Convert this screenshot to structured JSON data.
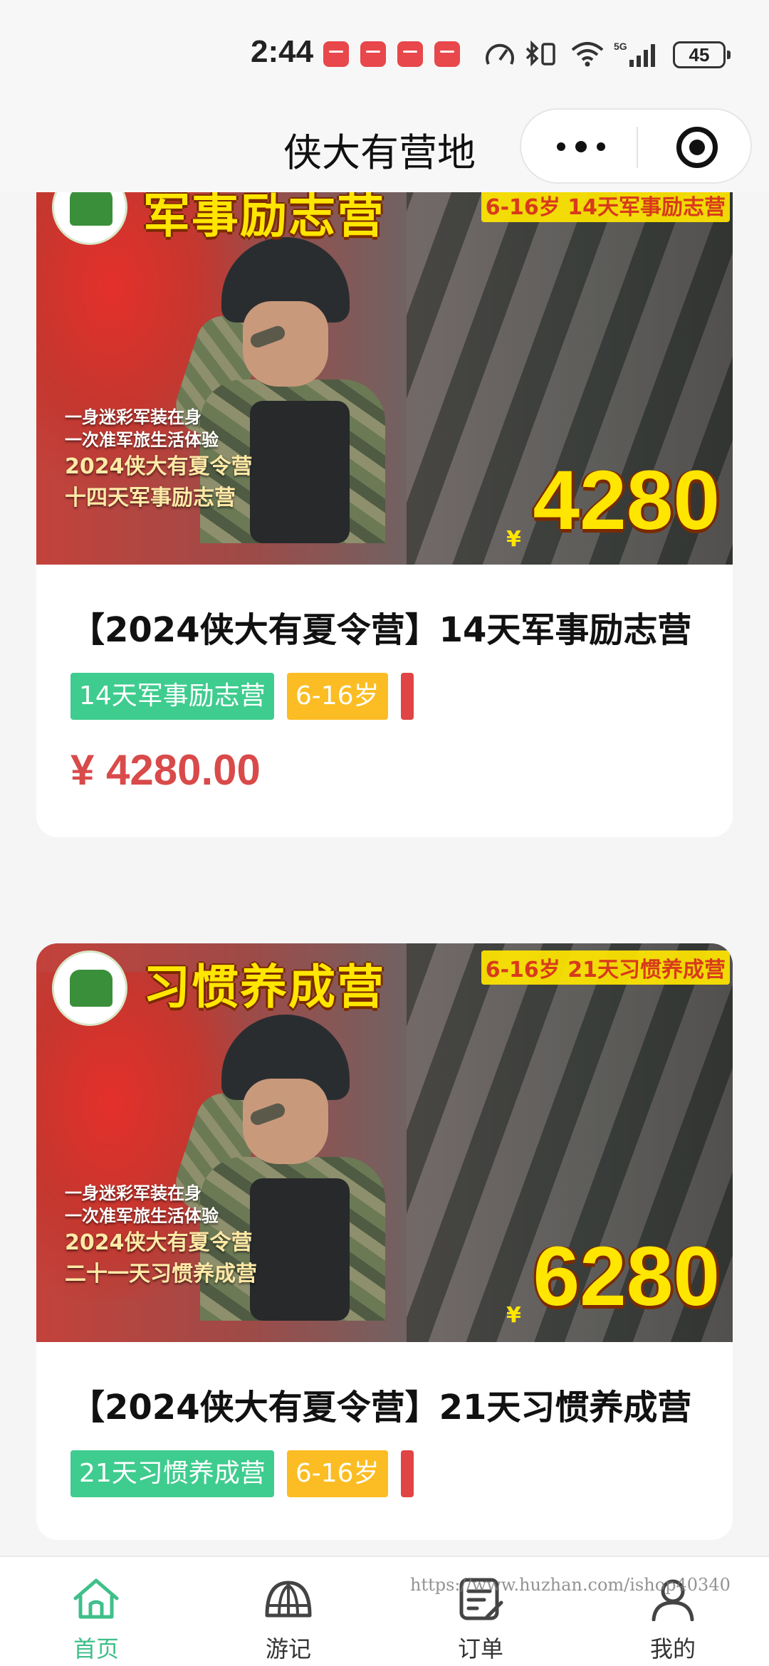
{
  "status_bar": {
    "time": "2:44",
    "battery": "45"
  },
  "nav": {
    "title": "侠大有营地"
  },
  "products": [
    {
      "image": {
        "headline": "军事励志营",
        "corner_text": "6-16岁 14天军事励志营",
        "line1": "一身迷彩军装在身",
        "line2": "一次准军旅生活体验",
        "line3": "2024侠大有夏令营",
        "line4": "十四天军事励志营",
        "yen": "¥",
        "price": "4280"
      },
      "title": "【2024侠大有夏令营】14天军事励志营",
      "tags": [
        "14天军事励志营",
        "6-16岁",
        ""
      ],
      "price": "¥ 4280.00"
    },
    {
      "image": {
        "headline": "习惯养成营",
        "corner_text": "6-16岁 21天习惯养成营",
        "line1": "一身迷彩军装在身",
        "line2": "一次准军旅生活体验",
        "line3": "2024侠大有夏令营",
        "line4": "二十一天习惯养成营",
        "yen": "¥",
        "price": "6280"
      },
      "title": "【2024侠大有夏令营】21天习惯养成营",
      "tags": [
        "21天习惯养成营",
        "6-16岁",
        ""
      ],
      "price": ""
    }
  ],
  "tabs": [
    {
      "label": "首页",
      "icon": "home-icon",
      "active": true
    },
    {
      "label": "游记",
      "icon": "dome-icon",
      "active": false
    },
    {
      "label": "订单",
      "icon": "order-list-icon",
      "active": false
    },
    {
      "label": "我的",
      "icon": "user-icon",
      "active": false
    }
  ],
  "watermark": "https://www.huzhan.com/ishop40340",
  "colors": {
    "accent_green": "#3fcc8f",
    "tag_yellow": "#fbbd23",
    "price_red": "#d94a4a"
  }
}
